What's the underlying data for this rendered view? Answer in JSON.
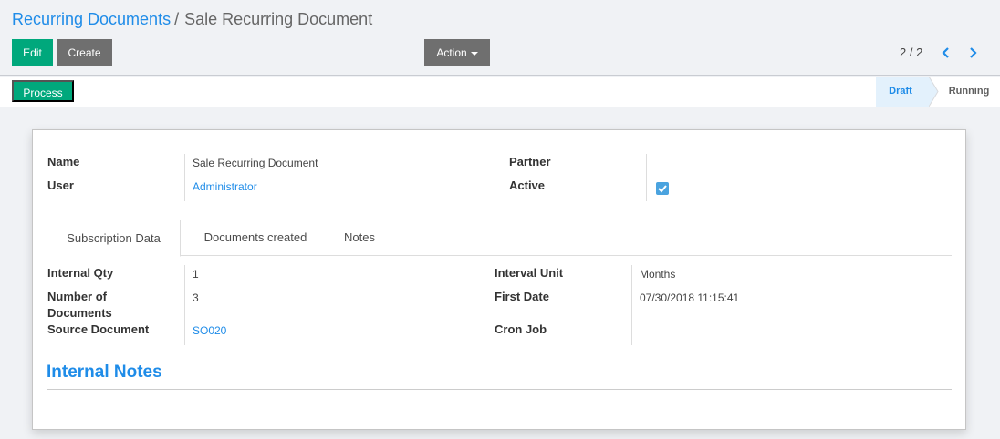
{
  "breadcrumb": {
    "parent": "Recurring Documents",
    "separator": "/",
    "current": "Sale Recurring Document"
  },
  "toolbar": {
    "edit": "Edit",
    "create": "Create",
    "action": "Action"
  },
  "pager": {
    "text": "2 / 2"
  },
  "statusbar": {
    "process": "Process",
    "stages": [
      "Draft",
      "Running"
    ],
    "active_stage": "Draft"
  },
  "form": {
    "name_label": "Name",
    "name_value": "Sale Recurring Document",
    "user_label": "User",
    "user_value": "Administrator",
    "partner_label": "Partner",
    "partner_value": "",
    "active_label": "Active",
    "active_checked": true
  },
  "tabs": [
    "Subscription Data",
    "Documents created",
    "Notes"
  ],
  "subscription": {
    "internal_qty_label": "Internal Qty",
    "internal_qty_value": "1",
    "num_docs_label_1": "Number of",
    "num_docs_label_2": "Documents",
    "num_docs_value": "3",
    "source_doc_label": "Source Document",
    "source_doc_value": "SO020",
    "interval_unit_label": "Interval Unit",
    "interval_unit_value": "Months",
    "first_date_label": "First Date",
    "first_date_value": "07/30/2018 11:15:41",
    "cron_job_label": "Cron Job",
    "cron_job_value": ""
  },
  "notes_section": {
    "title": "Internal Notes"
  },
  "colors": {
    "primary": "#00a87c",
    "secondary": "#6f6f6f",
    "link": "#1f8ce8",
    "stage_active_bg": "#e3f1fc"
  },
  "icons": {
    "prev": "chevron-left-icon",
    "next": "chevron-right-icon",
    "check": "check-icon",
    "caret": "caret-down-icon"
  }
}
